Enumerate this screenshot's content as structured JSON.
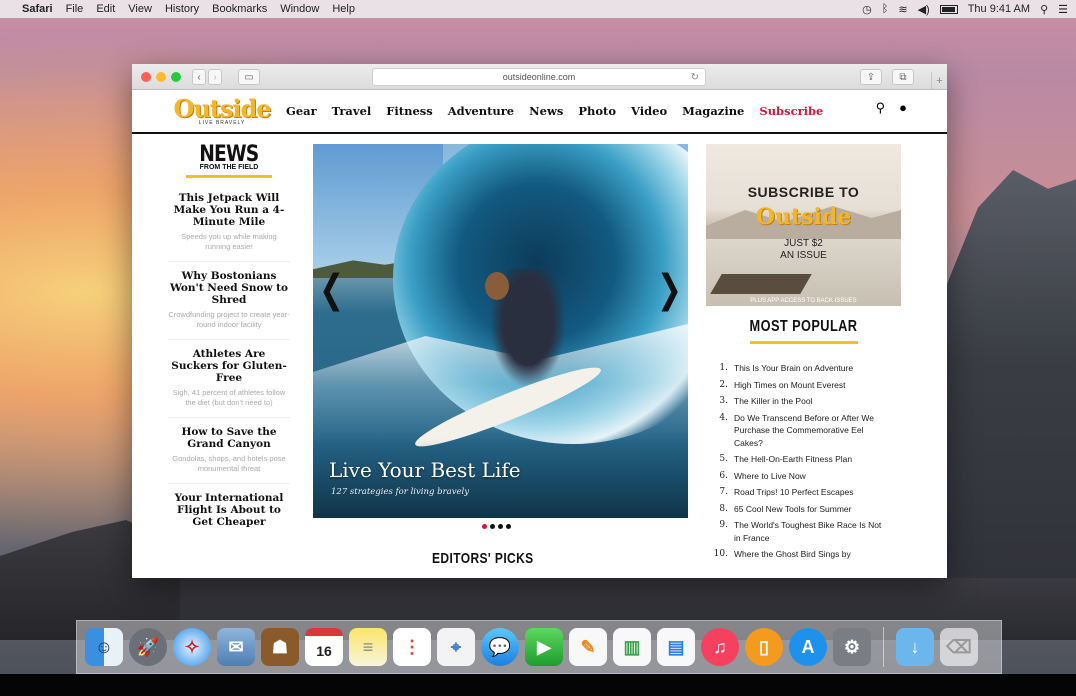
{
  "menubar": {
    "apple": "",
    "items": [
      "Safari",
      "File",
      "Edit",
      "View",
      "History",
      "Bookmarks",
      "Window",
      "Help"
    ],
    "clock": "Thu 9:41 AM"
  },
  "browser": {
    "url": "outsideonline.com"
  },
  "site": {
    "logo": "Outside",
    "logo_tagline": "LIVE BRAVELY",
    "nav": [
      "Gear",
      "Travel",
      "Fitness",
      "Adventure",
      "News",
      "Photo",
      "Video",
      "Magazine"
    ],
    "subscribe": "Subscribe"
  },
  "news_section": {
    "title": "NEWS",
    "subtitle": "FROM THE FIELD",
    "stories": [
      {
        "headline": "This Jetpack Will Make You Run a 4-Minute Mile",
        "dek": "Speeds you up while making running easier"
      },
      {
        "headline": "Why Bostonians Won't Need Snow to Shred",
        "dek": "Crowdfunding project to create year-round indoor facility"
      },
      {
        "headline": "Athletes Are Suckers for Gluten-Free",
        "dek": "Sigh, 41 percent of athletes follow the diet (but don't need to)"
      },
      {
        "headline": "How to Save the Grand Canyon",
        "dek": "Gondolas, shops, and hotels pose monumental threat"
      },
      {
        "headline": "Your International Flight Is About to Get Cheaper",
        "dek": ""
      }
    ]
  },
  "hero": {
    "title": "Live Your Best Life",
    "subtitle": "127 strategies for living bravely",
    "prev": "❮",
    "next": "❯",
    "slides": 4,
    "active_slide": 1
  },
  "editors_picks": "EDITORS' PICKS",
  "ad": {
    "headline": "SUBSCRIBE TO",
    "brand": "Outside",
    "offer_line1": "JUST $2",
    "offer_line2": "AN ISSUE",
    "fine_print": "PLUS APP ACCESS TO BACK ISSUES"
  },
  "most_popular": {
    "title": "MOST POPULAR",
    "items": [
      "This Is Your Brain on Adventure",
      "High Times on Mount Everest",
      "The Killer in the Pool",
      "Do We Transcend Before or After We Purchase the Commemorative Eel Cakes?",
      "The Hell-On-Earth Fitness Plan",
      "Where to Live Now",
      "Road Trips! 10 Perfect Escapes",
      "65 Cool New Tools for Summer",
      "The World's Toughest Bike Race Is Not in France",
      "Where the Ghost Bird Sings by"
    ]
  },
  "dock": {
    "calendar_month": "OCT",
    "calendar_day": "16"
  },
  "colors": {
    "brand_yellow": "#f2b62a",
    "subscribe_red": "#d0173c",
    "accent_bar": "#f2c314"
  }
}
